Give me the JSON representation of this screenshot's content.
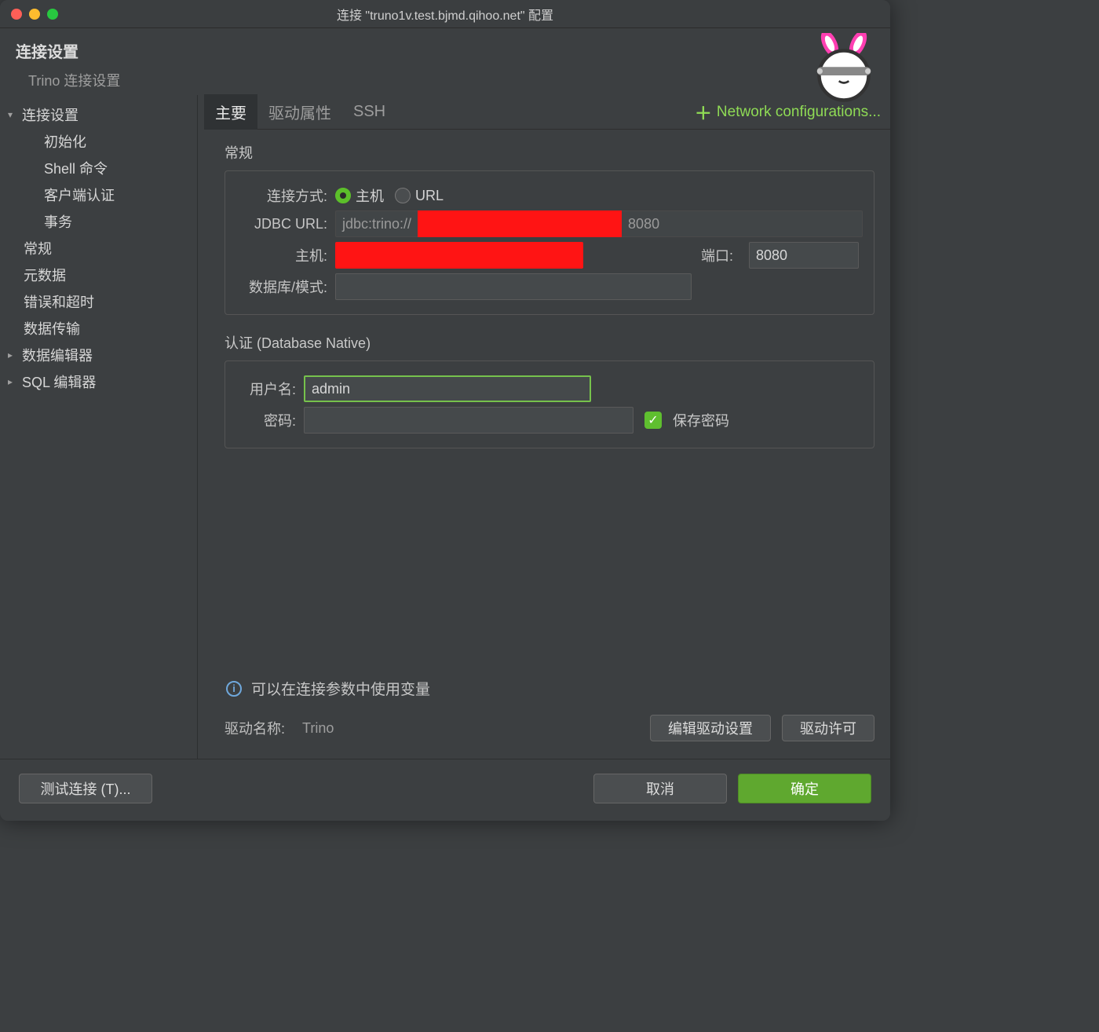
{
  "window": {
    "title": "连接 \"truno1v.test.bjmd.qihoo.net\" 配置"
  },
  "header": {
    "title": "连接设置",
    "subtitle": "Trino 连接设置"
  },
  "sidebar": {
    "items": [
      {
        "label": "连接设置",
        "expandable": true,
        "expanded": true,
        "level": 0
      },
      {
        "label": "初始化",
        "expandable": false,
        "level": 1
      },
      {
        "label": "Shell 命令",
        "expandable": false,
        "level": 1
      },
      {
        "label": "客户端认证",
        "expandable": false,
        "level": 1
      },
      {
        "label": "事务",
        "expandable": false,
        "level": 1
      },
      {
        "label": "常规",
        "expandable": false,
        "level": 0
      },
      {
        "label": "元数据",
        "expandable": false,
        "level": 0
      },
      {
        "label": "错误和超时",
        "expandable": false,
        "level": 0
      },
      {
        "label": "数据传输",
        "expandable": false,
        "level": 0
      },
      {
        "label": "数据编辑器",
        "expandable": true,
        "expanded": false,
        "level": 0
      },
      {
        "label": "SQL 编辑器",
        "expandable": true,
        "expanded": false,
        "level": 0
      }
    ]
  },
  "tabs": {
    "items": [
      "主要",
      "驱动属性",
      "SSH"
    ],
    "active": 0,
    "network_config": "Network configurations..."
  },
  "general": {
    "title": "常规",
    "connect_by_label": "连接方式:",
    "connect_by_host": "主机",
    "connect_by_url": "URL",
    "jdbc_label": "JDBC URL:",
    "jdbc_prefix": "jdbc:trino://",
    "jdbc_port": "8080",
    "host_label": "主机:",
    "port_label": "端口:",
    "port_value": "8080",
    "db_label": "数据库/模式:",
    "db_value": ""
  },
  "auth": {
    "title": "认证 (Database Native)",
    "user_label": "用户名:",
    "user_value": "admin",
    "pass_label": "密码:",
    "pass_value": "",
    "save_pass_label": "保存密码"
  },
  "info": {
    "text": "可以在连接参数中使用变量"
  },
  "driver": {
    "label": "驱动名称:",
    "name": "Trino",
    "edit_btn": "编辑驱动设置",
    "license_btn": "驱动许可"
  },
  "footer": {
    "test": "测试连接 (T)...",
    "cancel": "取消",
    "ok": "确定"
  }
}
